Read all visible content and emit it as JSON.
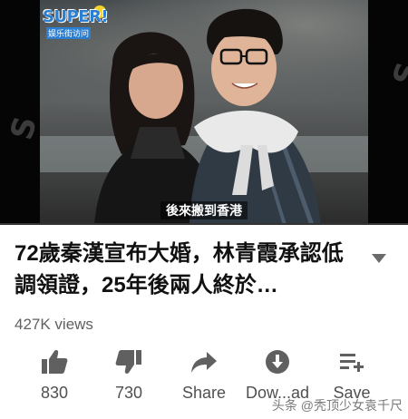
{
  "video": {
    "logo_text": "SUPER!",
    "logo_sub": "娱乐街访问",
    "subtitle": "後來搬到香港",
    "watermark_letter": "S",
    "progress_fraction": 0.0
  },
  "meta": {
    "title": "72歲秦漢宣布大婚，林青霞承認低調領證，25年後兩人終於…",
    "views": "427K views"
  },
  "actions": [
    {
      "icon": "thumb-up-icon",
      "label": "830"
    },
    {
      "icon": "thumb-down-icon",
      "label": "730"
    },
    {
      "icon": "share-icon",
      "label": "Share"
    },
    {
      "icon": "download-icon",
      "label": "Dow...ad"
    },
    {
      "icon": "playlist-add-icon",
      "label": "Save"
    }
  ],
  "overlay_watermark": "头条 @秃顶少女袁千尺",
  "colors": {
    "progress": "#ff0000",
    "icon": "#606060",
    "text": "#111111"
  }
}
